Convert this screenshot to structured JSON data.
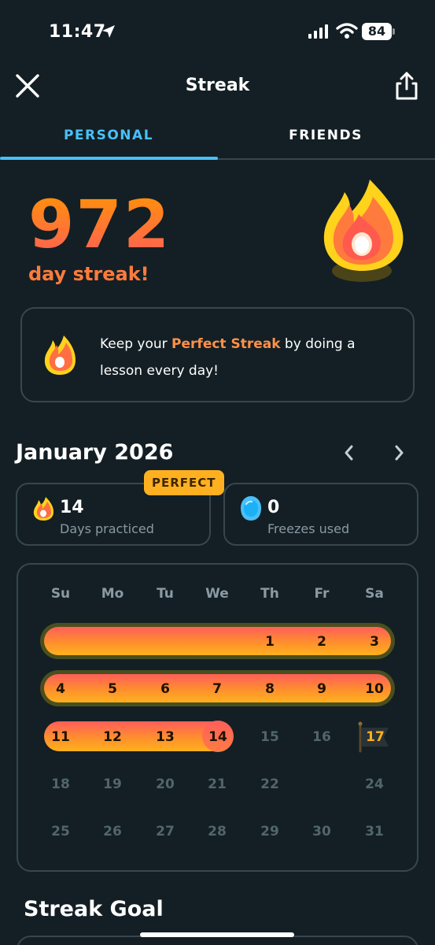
{
  "status_bar": {
    "time": "11:47",
    "battery": "84"
  },
  "header": {
    "title": "Streak"
  },
  "tabs": [
    {
      "label": "PERSONAL",
      "active": true
    },
    {
      "label": "FRIENDS",
      "active": false
    }
  ],
  "streak": {
    "count": "972",
    "label": "day streak!"
  },
  "info_card": {
    "prefix": "Keep your ",
    "highlight": "Perfect Streak",
    "suffix": " by doing a lesson every day!"
  },
  "calendar": {
    "month": "January 2026",
    "perfect_badge": "PERFECT",
    "stats": {
      "days_practiced": {
        "value": "14",
        "label": "Days practiced"
      },
      "freezes_used": {
        "value": "0",
        "label": "Freezes used"
      }
    },
    "weekdays": [
      "Su",
      "Mo",
      "Tu",
      "We",
      "Th",
      "Fr",
      "Sa"
    ],
    "weeks": [
      [
        "",
        "",
        "",
        "",
        "1",
        "2",
        "3"
      ],
      [
        "4",
        "5",
        "6",
        "7",
        "8",
        "9",
        "10"
      ],
      [
        "11",
        "12",
        "13",
        "14",
        "15",
        "16",
        "17"
      ],
      [
        "18",
        "19",
        "20",
        "21",
        "22",
        "",
        "24"
      ],
      [
        "25",
        "26",
        "27",
        "28",
        "29",
        "30",
        "31"
      ]
    ],
    "today": "14",
    "goal_day": "17"
  },
  "streak_goal": {
    "title": "Streak Goal"
  },
  "colors": {
    "background": "#131f24",
    "accent_blue": "#49c0f8",
    "streak_orange": "#ff9149",
    "border": "#37464f",
    "badge_gold": "#ffb020"
  },
  "icons": [
    "location-arrow-icon",
    "signal-icon",
    "wifi-icon",
    "close-icon",
    "share-icon",
    "flame-icon",
    "freeze-icon",
    "chevron-left-icon",
    "chevron-right-icon",
    "flag-icon"
  ]
}
